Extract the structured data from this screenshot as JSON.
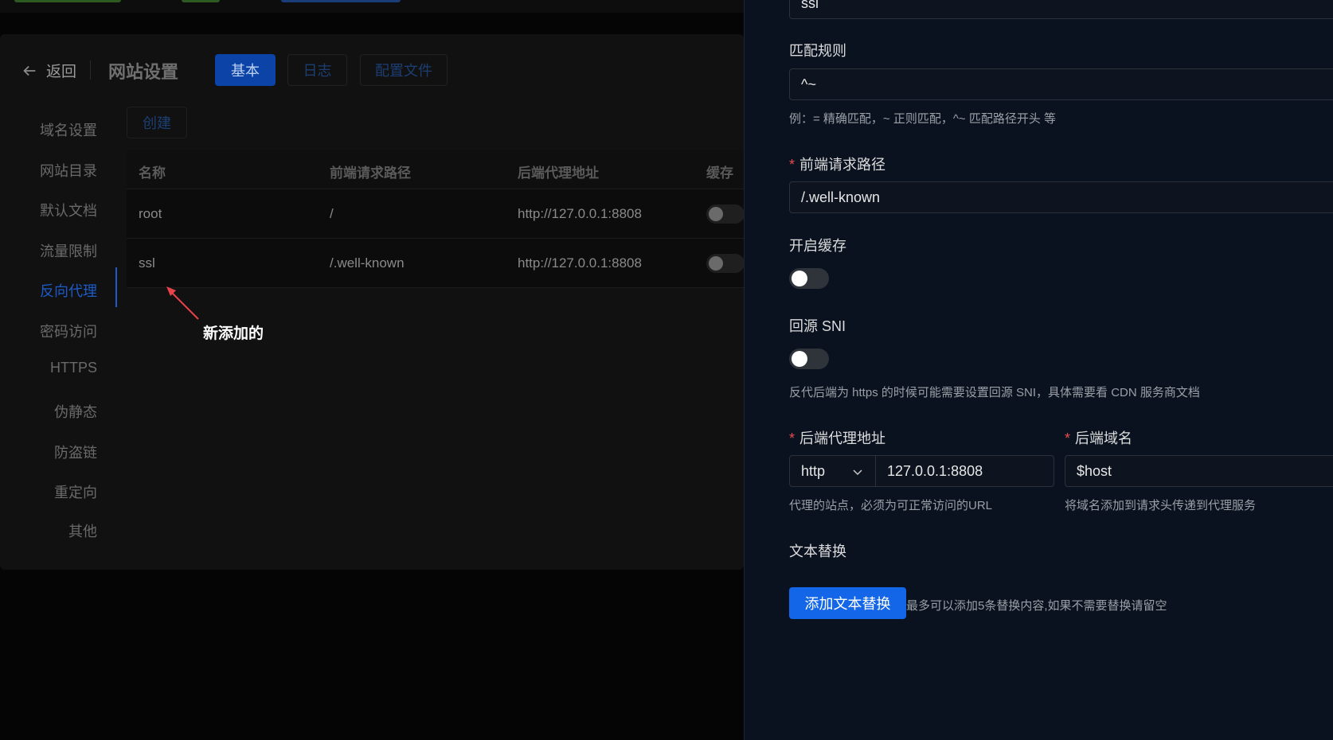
{
  "header": {
    "back_label": "返回",
    "title": "网站设置",
    "tabs": [
      {
        "label": "基本",
        "active": true
      },
      {
        "label": "日志",
        "active": false
      },
      {
        "label": "配置文件",
        "active": false
      }
    ]
  },
  "sidenav": {
    "items": [
      {
        "label": "域名设置",
        "active": false
      },
      {
        "label": "网站目录",
        "active": false
      },
      {
        "label": "默认文档",
        "active": false
      },
      {
        "label": "流量限制",
        "active": false
      },
      {
        "label": "反向代理",
        "active": true
      },
      {
        "label": "密码访问",
        "active": false
      },
      {
        "label": "HTTPS",
        "active": false
      },
      {
        "label": "伪静态",
        "active": false
      },
      {
        "label": "防盗链",
        "active": false
      },
      {
        "label": "重定向",
        "active": false
      },
      {
        "label": "其他",
        "active": false
      }
    ]
  },
  "content": {
    "create_label": "创建",
    "table": {
      "headers": [
        "名称",
        "前端请求路径",
        "后端代理地址",
        "缓存"
      ],
      "rows": [
        {
          "name": "root",
          "path": "/",
          "backend": "http://127.0.0.1:8808",
          "cache": false
        },
        {
          "name": "ssl",
          "path": "/.well-known",
          "backend": "http://127.0.0.1:8808",
          "cache": false
        }
      ]
    },
    "annotation": "新添加的"
  },
  "drawer": {
    "name_value": "ssl",
    "match_rule": {
      "label": "匹配规则",
      "value": "^~",
      "hint": "例：= 精确匹配，~ 正则匹配，^~ 匹配路径开头 等"
    },
    "frontend_path": {
      "label": "前端请求路径",
      "value": "/.well-known"
    },
    "cache": {
      "label": "开启缓存",
      "enabled": false
    },
    "sni": {
      "label": "回源 SNI",
      "enabled": false,
      "hint": "反代后端为 https 的时候可能需要设置回源 SNI，具体需要看 CDN 服务商文档"
    },
    "backend": {
      "label": "后端代理地址",
      "protocol": "http",
      "address": "127.0.0.1:8808",
      "hint": "代理的站点，必须为可正常访问的URL"
    },
    "backend_host": {
      "label": "后端域名",
      "value": "$host",
      "hint": "将域名添加到请求头传递到代理服务"
    },
    "text_replace": {
      "label": "文本替换",
      "button": "添加文本替换",
      "hint": "最多可以添加5条替换内容,如果不需要替换请留空"
    }
  },
  "colors": {
    "accent": "#1366e8",
    "active_tab": "#0c43a6",
    "required": "#e84d4d",
    "drawer_bg": "#0a1220"
  }
}
